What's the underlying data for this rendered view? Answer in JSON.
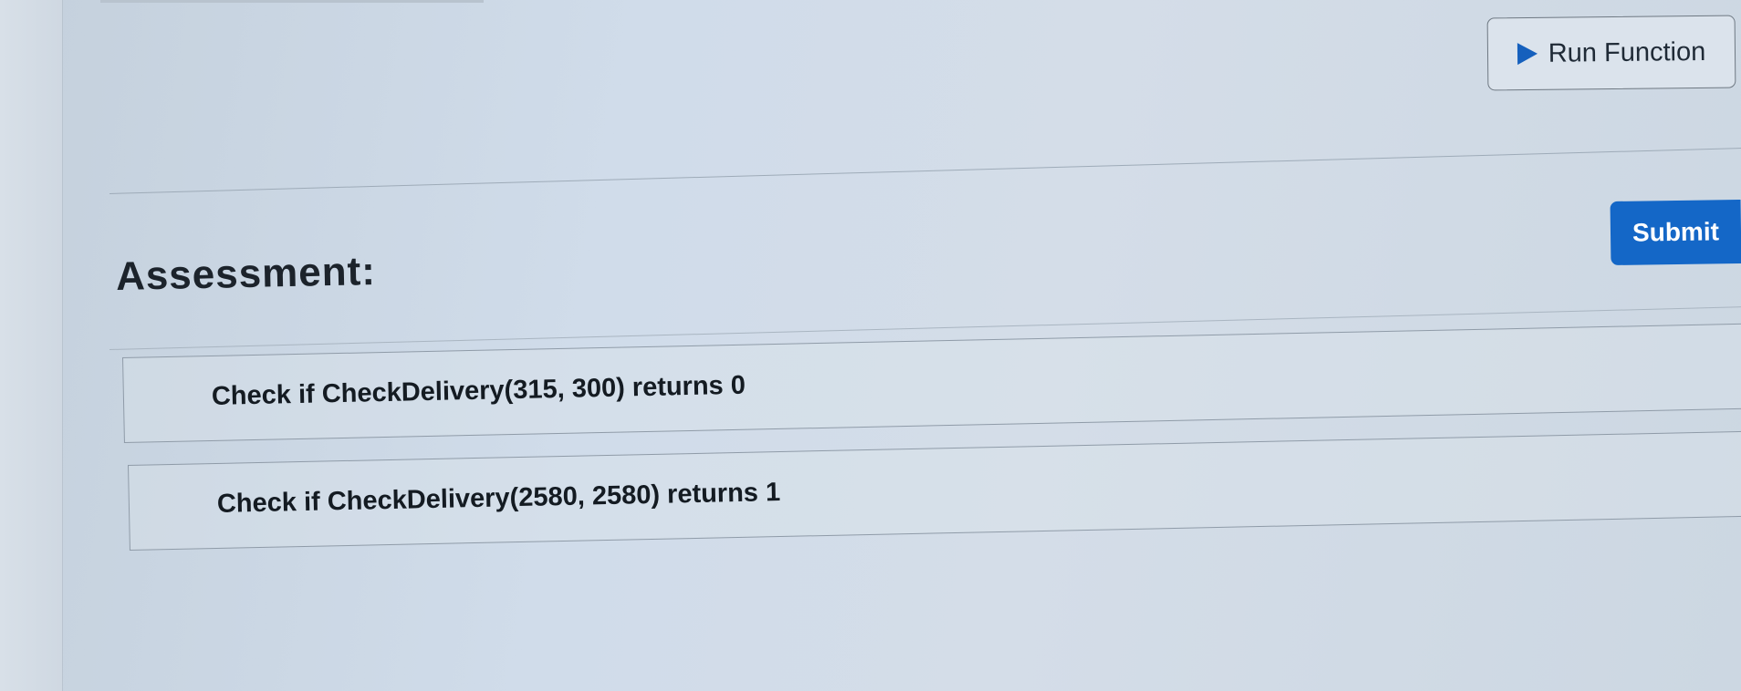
{
  "toolbar": {
    "run_label": "Run Function",
    "run_icon": "play-icon",
    "submit_label": "Submit",
    "accent_color": "#1467c7"
  },
  "assessment": {
    "title": "Assessment:",
    "checks": [
      {
        "label": "Check if CheckDelivery(315, 300) returns 0"
      },
      {
        "label": "Check if CheckDelivery(2580, 2580) returns 1"
      }
    ]
  }
}
